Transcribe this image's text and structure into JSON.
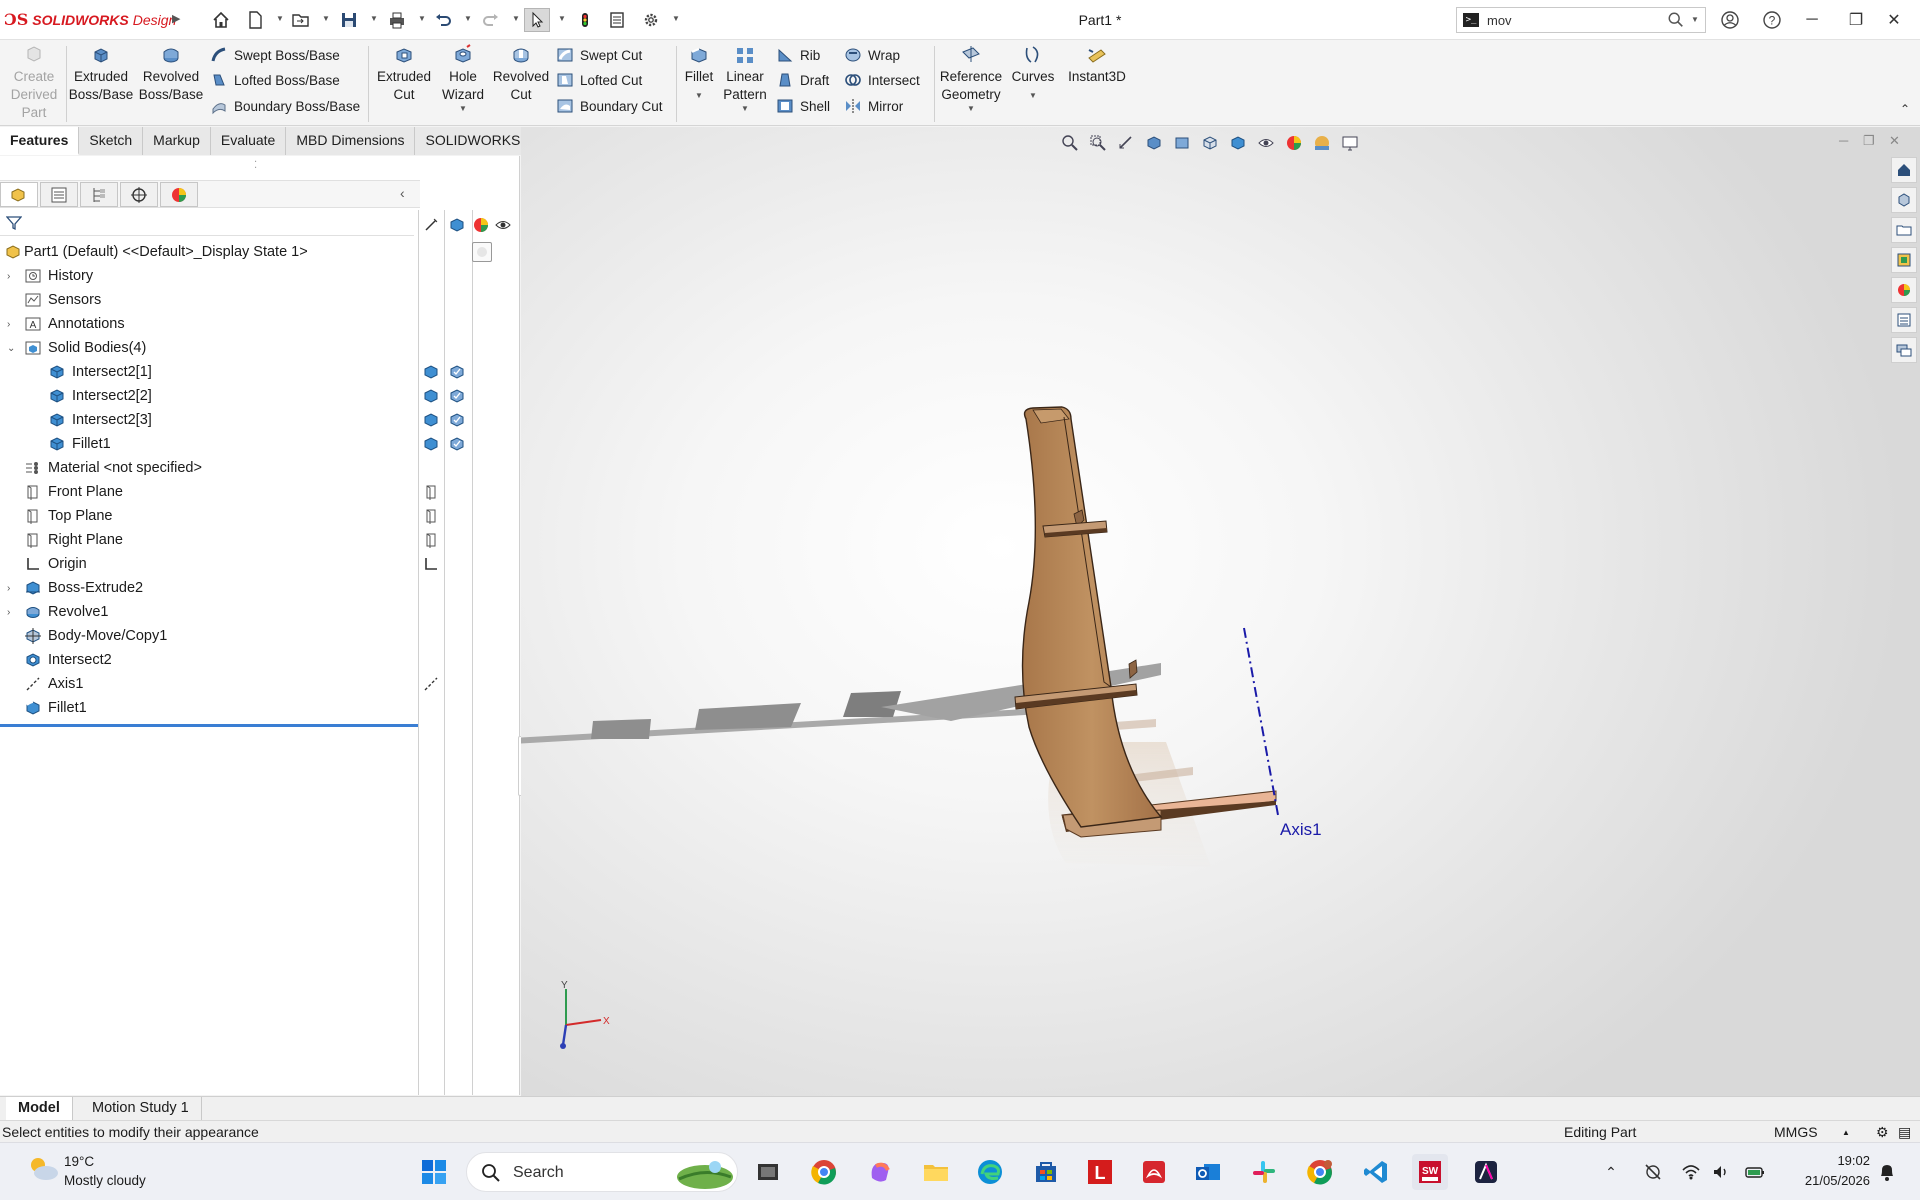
{
  "app": {
    "brand_prefix": "SOLIDWORKS",
    "brand_suffix": "Design",
    "document_title": "Part1 *",
    "command_search": {
      "value": "mov",
      "placeholder": ""
    }
  },
  "ribbon": {
    "create_derived_part": "Create Derived Part",
    "extruded_boss": "Extruded Boss/Base",
    "revolved_boss": "Revolved Boss/Base",
    "swept_boss": "Swept Boss/Base",
    "lofted_boss": "Lofted Boss/Base",
    "boundary_boss": "Boundary Boss/Base",
    "extruded_cut": "Extruded Cut",
    "hole_wizard": "Hole Wizard",
    "revolved_cut": "Revolved Cut",
    "swept_cut": "Swept Cut",
    "lofted_cut": "Lofted Cut",
    "boundary_cut": "Boundary Cut",
    "fillet": "Fillet",
    "linear_pattern": "Linear Pattern",
    "rib": "Rib",
    "draft": "Draft",
    "shell": "Shell",
    "wrap": "Wrap",
    "intersect": "Intersect",
    "mirror": "Mirror",
    "reference_geometry": "Reference Geometry",
    "curves": "Curves",
    "instant3d": "Instant3D"
  },
  "tabs": [
    "Features",
    "Sketch",
    "Markup",
    "Evaluate",
    "MBD Dimensions",
    "SOLIDWORKS Add-Ins"
  ],
  "tree": {
    "root": "Part1 (Default) <<Default>_Display State 1>",
    "items": [
      {
        "label": "History",
        "icon": "history-icon"
      },
      {
        "label": "Sensors",
        "icon": "sensor-icon"
      },
      {
        "label": "Annotations",
        "icon": "annotations-icon"
      },
      {
        "label": "Solid Bodies(4)",
        "icon": "solid-bodies-folder-icon"
      },
      {
        "label": "Intersect2[1]",
        "icon": "solid-body-icon"
      },
      {
        "label": "Intersect2[2]",
        "icon": "solid-body-icon"
      },
      {
        "label": "Intersect2[3]",
        "icon": "solid-body-icon"
      },
      {
        "label": "Fillet1",
        "icon": "solid-body-icon"
      },
      {
        "label": "Material <not specified>",
        "icon": "material-icon"
      },
      {
        "label": "Front Plane",
        "icon": "plane-icon"
      },
      {
        "label": "Top Plane",
        "icon": "plane-icon"
      },
      {
        "label": "Right Plane",
        "icon": "plane-icon"
      },
      {
        "label": "Origin",
        "icon": "origin-icon"
      },
      {
        "label": "Boss-Extrude2",
        "icon": "extrude-feature-icon"
      },
      {
        "label": "Revolve1",
        "icon": "revolve-feature-icon"
      },
      {
        "label": "Body-Move/Copy1",
        "icon": "move-copy-icon"
      },
      {
        "label": "Intersect2",
        "icon": "intersect-feature-icon"
      },
      {
        "label": "Axis1",
        "icon": "axis-icon"
      },
      {
        "label": "Fillet1",
        "icon": "fillet-feature-icon"
      }
    ]
  },
  "viewport": {
    "axis_label": "Axis1",
    "triad": {
      "x": "X",
      "y": "Y"
    },
    "colors": {
      "wood": "#b8895a",
      "wood_dark": "#5a3a22",
      "axis": "#1a1aa8"
    }
  },
  "bottom_tabs": [
    "Model",
    "Motion Study 1"
  ],
  "status": {
    "message": "Select entities to modify their appearance",
    "mode": "Editing Part",
    "units": "MMGS"
  },
  "taskbar": {
    "weather_temp": "19°C",
    "weather_desc": "Mostly cloudy",
    "search_label": "Search",
    "time": "19:02",
    "date": "21/05/2026"
  }
}
